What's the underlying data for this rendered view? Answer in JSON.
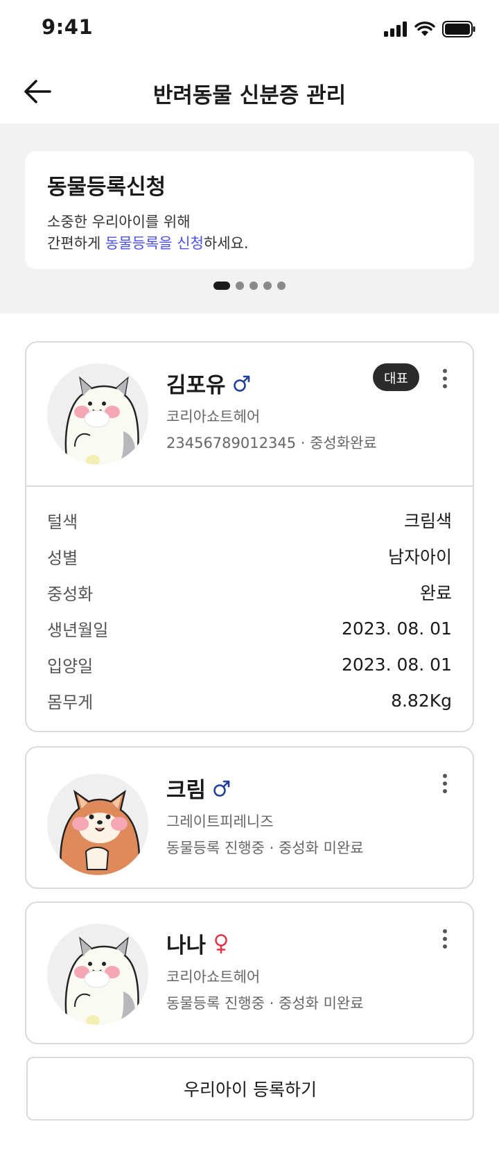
{
  "status_bar": {
    "time": "9:41"
  },
  "header": {
    "title": "반려동물 신분증 관리"
  },
  "banner": {
    "title": "동물등록신청",
    "line1": "소중한 우리아이를 위해",
    "line2_prefix": "간편하게 ",
    "line2_highlight": "동물등록을 신청",
    "line2_suffix": "하세요.",
    "pager_total": 5,
    "pager_active": 1
  },
  "pets": [
    {
      "name": "김포유",
      "gender": "♂",
      "gender_color": "#1e3f9a",
      "breed": "코리아쇼트헤어",
      "sub": "23456789012345 · 중성화완료",
      "badge": "대표",
      "avatar": "cat-avatar",
      "details": [
        {
          "label": "털색",
          "value": "크림색"
        },
        {
          "label": "성별",
          "value": "남자아이"
        },
        {
          "label": "중성화",
          "value": "완료"
        },
        {
          "label": "생년월일",
          "value": "2023. 08. 01"
        },
        {
          "label": "입양일",
          "value": "2023. 08. 01"
        },
        {
          "label": "몸무게",
          "value": "8.82Kg"
        }
      ]
    },
    {
      "name": "크림",
      "gender": "♂",
      "gender_color": "#1e3f9a",
      "breed": "그레이트피레니즈",
      "sub": "동물등록 진행중 · 중성화 미완료",
      "avatar": "dog-avatar"
    },
    {
      "name": "나나",
      "gender": "♀",
      "gender_color": "#e0344a",
      "breed": "코리아쇼트헤어",
      "sub": "동물등록 진행중 · 중성화 미완료",
      "avatar": "cat-avatar"
    }
  ],
  "register_button": "우리아이 등록하기",
  "colors": {
    "accent": "#4a50e8",
    "badge_bg": "#2b2b2b",
    "page_gray": "#f2f2f2"
  }
}
